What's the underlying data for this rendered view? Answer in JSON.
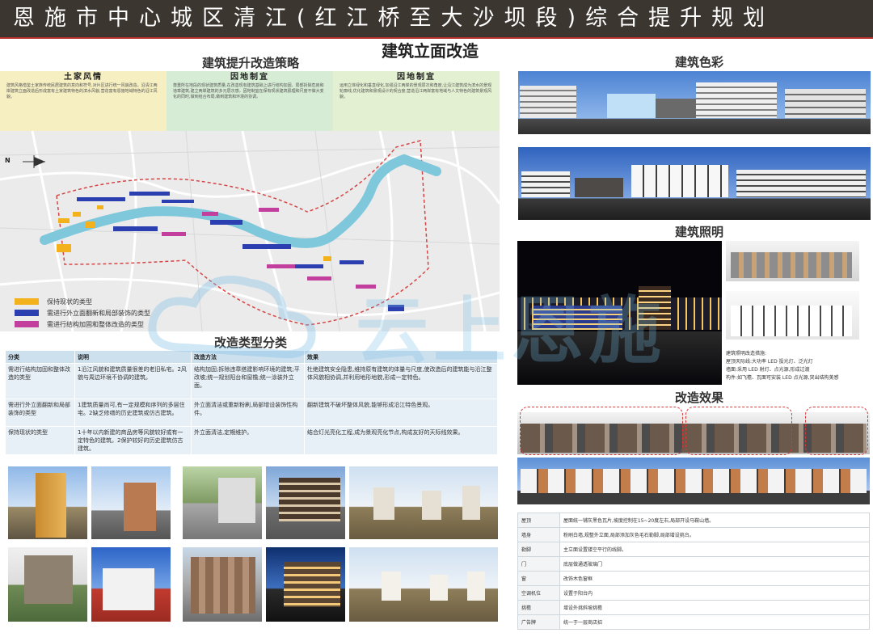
{
  "banner": {
    "title": "恩施市中心城区清江(红江桥至大沙坝段)综合提升规划"
  },
  "page_title": "建筑立面改造",
  "strategy": {
    "heading": "建筑提升改造策略",
    "cards": [
      {
        "title": "土家风情",
        "text": "建筑风格借鉴土家族传统民居建筑的意向和符号,对片区进行统一风貌改造。沿清江两岸建筑立面改造后形成富有土家建筑特色的滨水风貌,营造富有恩施地域特色的沿江风貌。",
        "color": "#f6efc2"
      },
      {
        "title": "因地制宜",
        "text": "尊重所在地段的现状建筑质量,在改善现有建筑基础上进行结构加固、局部拆除危房和违章建筑,建立两岸建筑的多元层次感。因地制宜在保有现状建筑肌理和尺度不做大变化的同时,做到结合布局,做到建筑和环境的协调。",
        "color": "#d6ecd4"
      },
      {
        "title": "因地制宜",
        "text": "运用立体绿化和垂直绿化,加强沿江两岸的景观层次和角度,让沿江建筑成为滨水的景观轮廓线,优化建筑和景观设计的契合度,营造沿江两岸富有地域与人文特色的建筑景观风貌。",
        "color": "#e3f0d1"
      }
    ]
  },
  "map": {
    "compass": "N",
    "legend": [
      {
        "label": "保持现状的类型",
        "color": "#f3b21c"
      },
      {
        "label": "需进行外立面翻新和局部装饰的类型",
        "color": "#2b3fb0"
      },
      {
        "label": "需进行结构加固和整体改造的类型",
        "color": "#c23f9e"
      }
    ]
  },
  "types": {
    "heading": "改造类型分类",
    "columns": [
      "分类",
      "说明",
      "改造方法",
      "效果"
    ],
    "rows": [
      [
        "需进行结构加固和整体改造的类型",
        "1沿江风貌和建筑质量很差的老旧私宅。2风貌与周边环境不协调的建筑。",
        "结构加固;拆除违章搭建影响环境的建筑;平改坡;统一规划阳台和窗檐;统一涂装外立面。",
        "杜绝建筑安全隐患,维持原有建筑的体量与尺度,使改造后的建筑能与沿江整体风貌相协调,并利用地形地貌,形成一定特色。"
      ],
      [
        "需进行外立面翻新和局部装饰的类型",
        "1建筑质量尚可,有一定规模和序列的多层住宅。2缺乏修缮的历史建筑或仿古建筑。",
        "外立面清洁或重新粉刷,局部增设装饰性构件。",
        "翻新建筑不破坏整体风貌,能够形成沿江特色景观。"
      ],
      [
        "保持现状的类型",
        "1十年以内新建的商品房等风貌较好或有一定特色的建筑。2保护较好的历史建筑仿古建筑。",
        "外立面清洁,定期维护。",
        "结合灯光亮化工程,成为景观亮化节点,构成友好的天际线效果。"
      ]
    ]
  },
  "color_section": {
    "heading": "建筑色彩"
  },
  "lighting": {
    "heading": "建筑照明",
    "notes": [
      "建筑照明改造措施:",
      "屋顶天际线:大功率 LED 投光灯、泛光灯",
      "墙面:采用 LED 射灯、点光源,形成过渡",
      "构件:如飞檐、瓦面可安装 LED 点光源,突出结构美感"
    ]
  },
  "effect": {
    "heading": "改造效果",
    "specs": [
      {
        "key": "屋顶",
        "value": "屋面统一铺灰黑色瓦片,坡度控制在15~20度左右,局部开设马鞍山墙。"
      },
      {
        "key": "墙身",
        "value": "粉刷白墙,规整外立面,局部添加灰色毛石勒脚,局部增设挑台。"
      },
      {
        "key": "勒脚",
        "value": "主立面设置镂空平行的线脚。"
      },
      {
        "key": "门",
        "value": "底层做通透玻璃门"
      },
      {
        "key": "窗",
        "value": "改饰木色窗框"
      },
      {
        "key": "空调机位",
        "value": "设置于阳台内"
      },
      {
        "key": "挑檐",
        "value": "增设外挑斜坡挑檐"
      },
      {
        "key": "广告牌",
        "value": "统一于一层商店招"
      }
    ]
  },
  "watermark": {
    "text": "云上恩施"
  },
  "colors": {
    "banner": "#3c3631",
    "accent": "#b7302a",
    "river": "#7fc8dc",
    "sky": "#5b8fd6"
  }
}
